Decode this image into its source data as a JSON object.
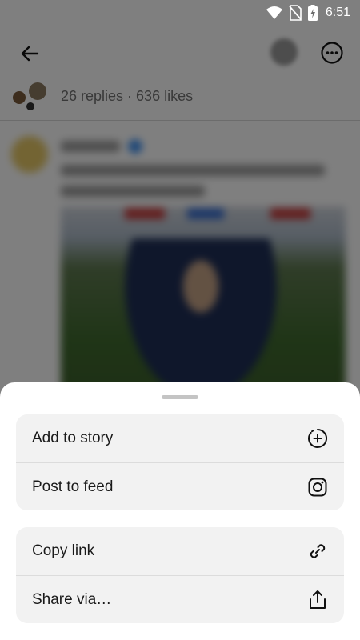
{
  "status_bar": {
    "time": "6:51",
    "icons": [
      "wifi-icon",
      "no-sim-icon",
      "battery-charging-icon"
    ]
  },
  "header": {
    "back_icon": "back-arrow-icon",
    "more_icon": "more-options-icon"
  },
  "thread": {
    "stats": "26 replies · 636 likes"
  },
  "sheet": {
    "group1": [
      {
        "label": "Add to story",
        "icon": "add-circle-dashed-icon"
      },
      {
        "label": "Post to feed",
        "icon": "instagram-icon"
      }
    ],
    "group2": [
      {
        "label": "Copy link",
        "icon": "link-icon"
      },
      {
        "label": "Share via…",
        "icon": "share-icon"
      }
    ]
  },
  "colors": {
    "scrim": "#000000",
    "sheet_background": "#ffffff",
    "row_background": "#f2f2f2",
    "text": "#1a1a1a"
  }
}
